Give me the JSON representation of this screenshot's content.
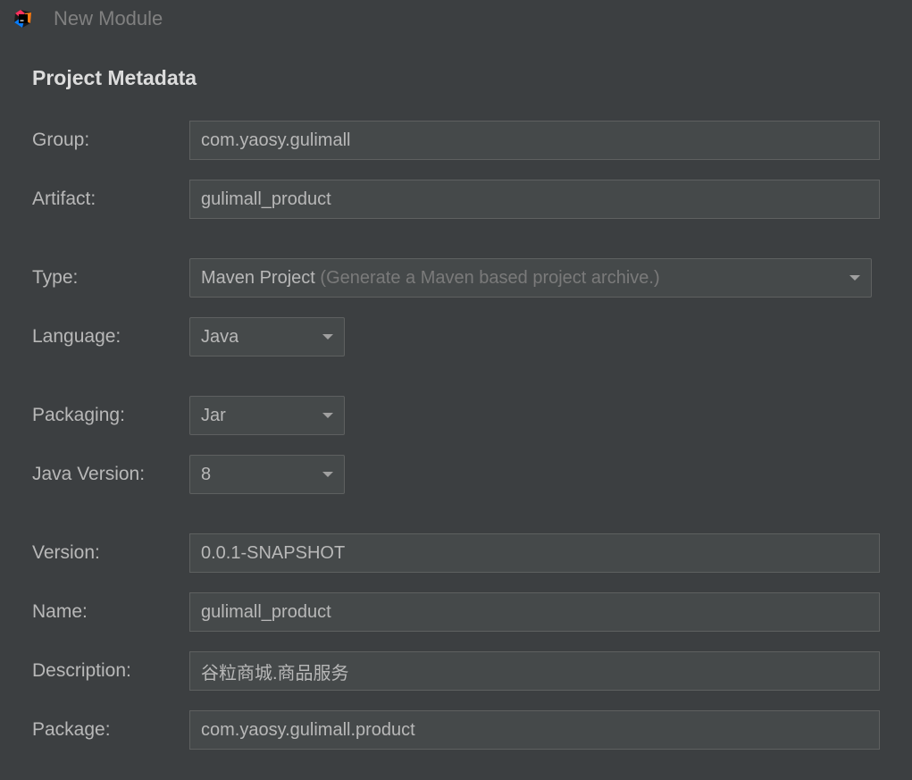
{
  "window": {
    "title": "New Module"
  },
  "section_title": "Project Metadata",
  "labels": {
    "group": "Group:",
    "artifact": "Artifact:",
    "type": "Type:",
    "language": "Language:",
    "packaging": "Packaging:",
    "java_version": "Java Version:",
    "version": "Version:",
    "name": "Name:",
    "description": "Description:",
    "package": "Package:"
  },
  "values": {
    "group": "com.yaosy.gulimall",
    "artifact": "gulimall_product",
    "type": "Maven Project",
    "type_hint": "(Generate a Maven based project archive.)",
    "language": "Java",
    "packaging": "Jar",
    "java_version": "8",
    "version": "0.0.1-SNAPSHOT",
    "name": "gulimall_product",
    "description": "谷粒商城.商品服务",
    "package": "com.yaosy.gulimall.product"
  }
}
